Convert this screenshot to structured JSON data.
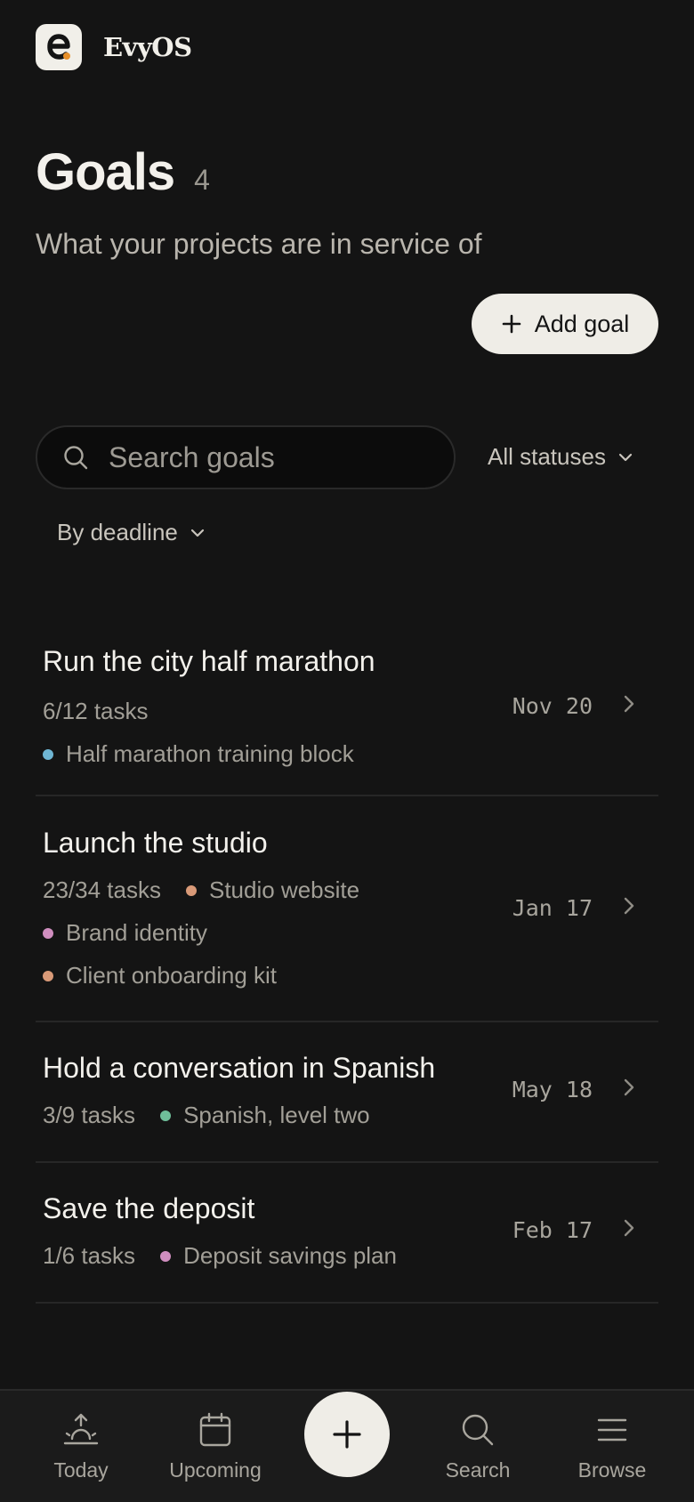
{
  "app": {
    "name": "EvyOS"
  },
  "page": {
    "title": "Goals",
    "count": "4",
    "subtitle": "What your projects are in service of",
    "add_label": "Add goal"
  },
  "filters": {
    "search_placeholder": "Search goals",
    "status_label": "All statuses",
    "sort_label": "By deadline"
  },
  "goals": [
    {
      "name": "Run the city half marathon",
      "tasks": "6/12 tasks",
      "date": "Nov 20",
      "projects": [
        {
          "name": "Half marathon training block",
          "color": "#6fb6d3"
        }
      ]
    },
    {
      "name": "Launch the studio",
      "tasks": "23/34 tasks",
      "date": "Jan 17",
      "projects": [
        {
          "name": "Studio website",
          "color": "#d99a78"
        },
        {
          "name": "Brand identity",
          "color": "#d08ebf"
        },
        {
          "name": "Client onboarding kit",
          "color": "#d99a78"
        }
      ]
    },
    {
      "name": "Hold a conversation in Spanish",
      "tasks": "3/9 tasks",
      "date": "May 18",
      "projects": [
        {
          "name": "Spanish, level two",
          "color": "#6fbf9a"
        }
      ]
    },
    {
      "name": "Save the deposit",
      "tasks": "1/6 tasks",
      "date": "Feb 17",
      "projects": [
        {
          "name": "Deposit savings plan",
          "color": "#d08ebf"
        }
      ]
    }
  ],
  "nav": {
    "items": [
      {
        "label": "Today",
        "icon": "sunrise-icon"
      },
      {
        "label": "Upcoming",
        "icon": "calendar-icon"
      },
      {
        "label": "Search",
        "icon": "search-icon"
      },
      {
        "label": "Browse",
        "icon": "menu-icon"
      }
    ],
    "fab_icon": "plus-icon"
  },
  "colors": {
    "background": "#141414",
    "accent_light": "#efede7",
    "logo_dot": "#e8902a"
  }
}
